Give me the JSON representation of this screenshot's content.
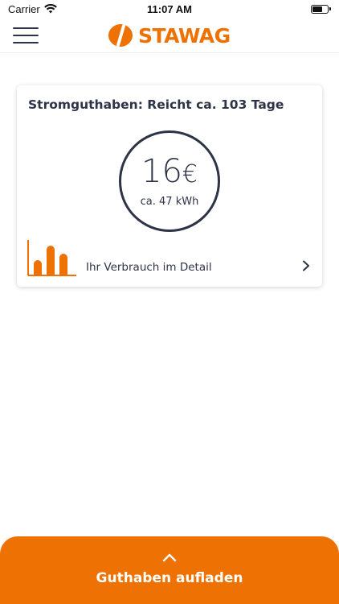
{
  "status_bar": {
    "carrier": "Carrier",
    "time": "11:07 AM"
  },
  "header": {
    "logo_text": "STAWAG",
    "brand_color": "#ee7203"
  },
  "card": {
    "title": "Stromguthaben: Reicht ca. 103 Tage",
    "balance_value": "16",
    "balance_currency": "€",
    "balance_kwh": "ca. 47 kWh",
    "detail_label": "Ihr Verbrauch im Detail"
  },
  "topup": {
    "label": "Guthaben aufladen"
  },
  "icons": [
    "wifi-icon",
    "battery-icon",
    "menu-icon",
    "logo-icon",
    "bar-chart-icon",
    "chevron-right-icon",
    "chevron-up-icon"
  ],
  "colors": {
    "accent": "#ee7203",
    "text": "#2e3447"
  }
}
